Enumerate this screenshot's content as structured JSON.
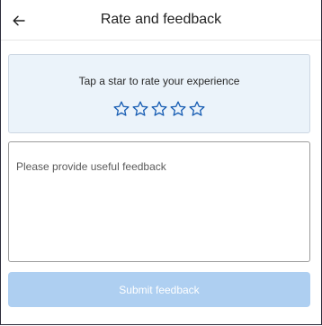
{
  "header": {
    "back_icon": "arrow-left-icon",
    "title": "Rate and feedback"
  },
  "rating": {
    "prompt": "Tap a star to rate your experience",
    "star_icon": "star-outline-icon",
    "max_stars": 5,
    "selected": 0
  },
  "feedback": {
    "placeholder": "Please provide useful feedback",
    "value": ""
  },
  "submit": {
    "label": "Submit feedback"
  },
  "colors": {
    "accent": "#1a5fb4",
    "rating_card_bg": "#ebf3fa",
    "submit_disabled_bg": "#aecff1"
  }
}
